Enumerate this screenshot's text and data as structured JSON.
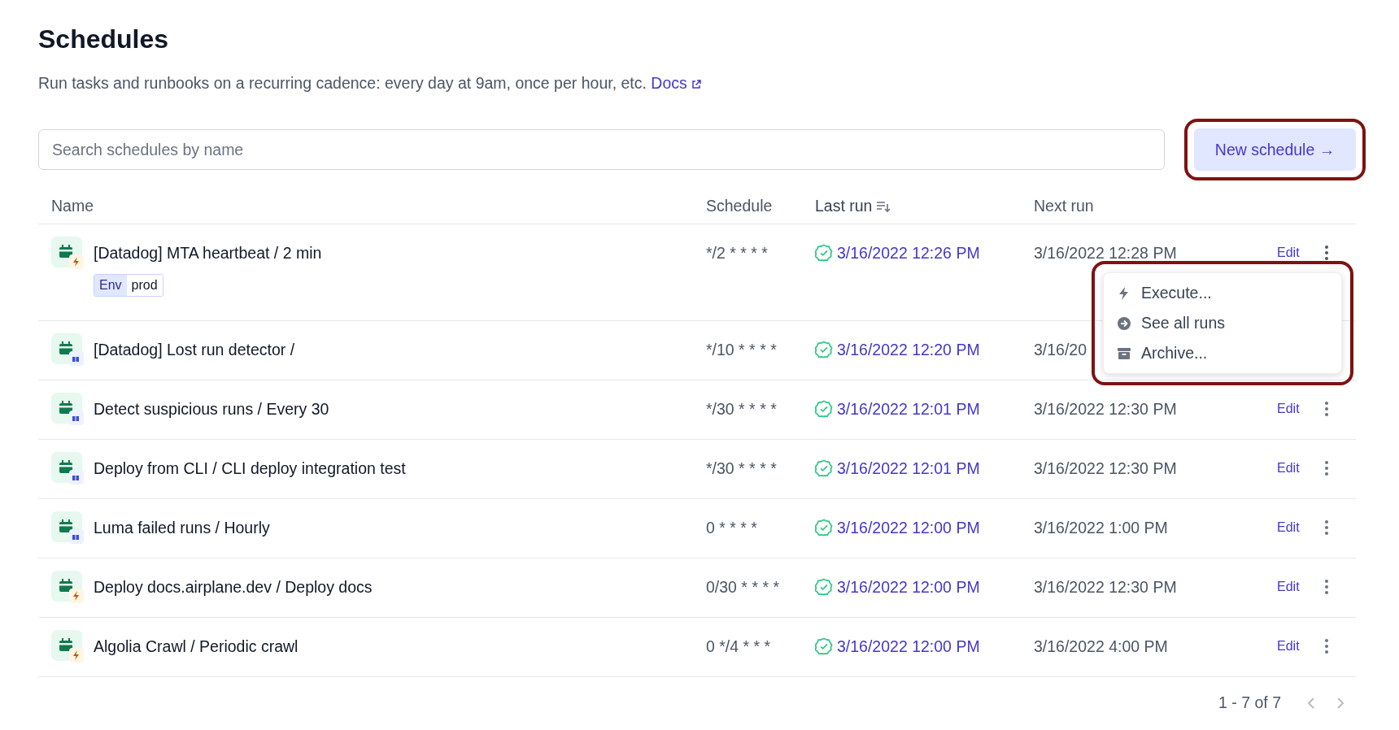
{
  "page": {
    "title": "Schedules",
    "description": "Run tasks and runbooks on a recurring cadence: every day at 9am, once per hour, etc.",
    "docs_link": "Docs"
  },
  "search": {
    "placeholder": "Search schedules by name"
  },
  "new_button": {
    "label": "New schedule →",
    "highlighted": true
  },
  "table": {
    "columns": [
      {
        "label": "Name",
        "sorted": false
      },
      {
        "label": "Schedule",
        "sorted": false
      },
      {
        "label": "Last run",
        "sorted": true
      },
      {
        "label": "Next run",
        "sorted": false
      }
    ],
    "rows": [
      {
        "kind": "task",
        "name": "[Datadog] MTA heartbeat / 2 min",
        "tags": [
          {
            "key": "Env",
            "value": "prod"
          }
        ],
        "cron": "*/2 * * * *",
        "last_run": "3/16/2022 12:26 PM",
        "succeeded": true,
        "next_run": "3/16/2022 12:28 PM",
        "edit": "Edit",
        "menu_open": true
      },
      {
        "kind": "runbook",
        "name": "[Datadog] Lost run detector /",
        "cron": "*/10 * * * *",
        "last_run": "3/16/2022 12:20 PM",
        "succeeded": true,
        "next_run": "3/16/20"
      },
      {
        "kind": "runbook",
        "name": "Detect suspicious runs / Every 30",
        "cron": "*/30 * * * *",
        "last_run": "3/16/2022 12:01 PM",
        "succeeded": true,
        "next_run": "3/16/2022 12:30 PM",
        "edit": "Edit",
        "menu_open": false
      },
      {
        "kind": "runbook",
        "name": "Deploy from CLI / CLI deploy integration test",
        "cron": "*/30 * * * *",
        "last_run": "3/16/2022 12:01 PM",
        "succeeded": true,
        "next_run": "3/16/2022 12:30 PM",
        "edit": "Edit",
        "menu_open": false
      },
      {
        "kind": "runbook",
        "name": "Luma failed runs / Hourly",
        "cron": "0 * * * *",
        "last_run": "3/16/2022 12:00 PM",
        "succeeded": true,
        "next_run": "3/16/2022 1:00 PM",
        "edit": "Edit",
        "menu_open": false
      },
      {
        "kind": "task",
        "name": "Deploy docs.airplane.dev / Deploy docs",
        "cron": "0/30 * * * *",
        "last_run": "3/16/2022 12:00 PM",
        "succeeded": true,
        "next_run": "3/16/2022 12:30 PM",
        "edit": "Edit",
        "menu_open": false
      },
      {
        "kind": "task",
        "name": "Algolia Crawl / Periodic crawl",
        "cron": "0 */4 * * *",
        "last_run": "3/16/2022 12:00 PM",
        "succeeded": true,
        "next_run": "3/16/2022 4:00 PM",
        "edit": "Edit",
        "menu_open": false
      }
    ]
  },
  "row_menu": {
    "highlighted": true,
    "items": [
      {
        "kind": "execute",
        "label": "Execute..."
      },
      {
        "kind": "runs",
        "label": "See all runs"
      },
      {
        "kind": "archive",
        "label": "Archive..."
      }
    ]
  },
  "pagination": {
    "range": "1 - 7 of 7",
    "prev_disabled": true,
    "next_disabled": true
  }
}
